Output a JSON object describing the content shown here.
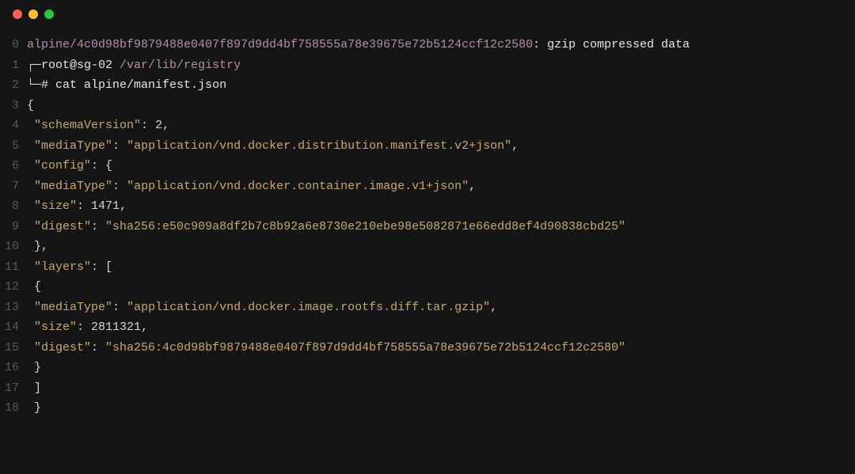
{
  "window": {
    "traffic": {
      "close": "close",
      "min": "minimize",
      "max": "maximize"
    }
  },
  "line0": {
    "path": "alpine/4c0d98bf9879488e0407f897d9dd4bf758555a78e39675e72b5124ccf12c2580",
    "sep": ": ",
    "info": "gzip compressed data"
  },
  "line1": {
    "pre": "┌─",
    "userhost": "root@sg-02 ",
    "dir": "/var/lib/registry"
  },
  "line2": {
    "pre": "└─",
    "hash": "# ",
    "cmd": "cat alpine/manifest.json"
  },
  "json": {
    "l3": "{",
    "l4": {
      "key": "\"schemaVersion\"",
      "post": ": ",
      "val": "2",
      "tail": ","
    },
    "l5": {
      "key": "\"mediaType\"",
      "post": ": ",
      "val": "\"application/vnd.docker.distribution.manifest.v2+json\"",
      "tail": ","
    },
    "l6": {
      "key": "\"config\"",
      "post": ": {"
    },
    "l7": {
      "key": "\"mediaType\"",
      "post": ": ",
      "val": "\"application/vnd.docker.container.image.v1+json\"",
      "tail": ","
    },
    "l8": {
      "key": "\"size\"",
      "post": ": ",
      "val": "1471",
      "tail": ","
    },
    "l9": {
      "key": "\"digest\"",
      "post": ": ",
      "val": "\"sha256:e50c909a8df2b7c8b92a6e8730e210ebe98e5082871e66edd8ef4d90838cbd25\""
    },
    "l10": "},",
    "l11": {
      "key": "\"layers\"",
      "post": ": ["
    },
    "l12": "{",
    "l13": {
      "key": "\"mediaType\"",
      "post": ": ",
      "val": "\"application/vnd.docker.image.rootfs.diff.tar.gzip\"",
      "tail": ","
    },
    "l14": {
      "key": "\"size\"",
      "post": ": ",
      "val": "2811321",
      "tail": ","
    },
    "l15": {
      "key": "\"digest\"",
      "post": ": ",
      "val": "\"sha256:4c0d98bf9879488e0407f897d9dd4bf758555a78e39675e72b5124ccf12c2580\""
    },
    "l16": "}",
    "l17": "]",
    "l18": "}"
  },
  "ln": {
    "n0": "0",
    "n1": "1",
    "n2": "2",
    "n3": "3",
    "n4": "4",
    "n5": "5",
    "n6": "6",
    "n7": "7",
    "n8": "8",
    "n9": "9",
    "n10": "10",
    "n11": "11",
    "n12": "12",
    "n13": "13",
    "n14": "14",
    "n15": "15",
    "n16": "16",
    "n17": "17",
    "n18": "18"
  }
}
